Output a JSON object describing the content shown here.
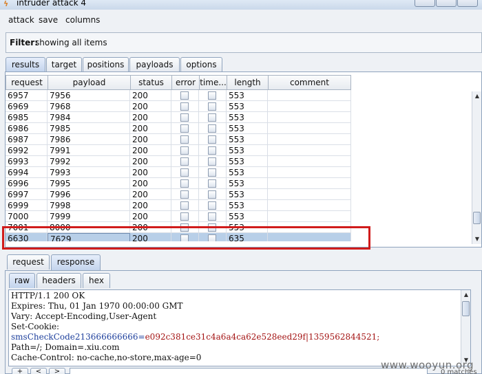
{
  "window": {
    "title": "intruder attack 4"
  },
  "menu": [
    "attack",
    "save",
    "columns"
  ],
  "filter": {
    "label": "Filter:",
    "value": "showing all items"
  },
  "main_tabs": [
    {
      "label": "results",
      "active": true
    },
    {
      "label": "target",
      "active": false
    },
    {
      "label": "positions",
      "active": false
    },
    {
      "label": "payloads",
      "active": false
    },
    {
      "label": "options",
      "active": false
    }
  ],
  "table": {
    "columns": [
      "request",
      "payload",
      "status",
      "error",
      "time...",
      "length",
      "comment"
    ],
    "rows": [
      {
        "request": "6957",
        "payload": "7956",
        "status": "200",
        "length": "553"
      },
      {
        "request": "6969",
        "payload": "7968",
        "status": "200",
        "length": "553"
      },
      {
        "request": "6985",
        "payload": "7984",
        "status": "200",
        "length": "553"
      },
      {
        "request": "6986",
        "payload": "7985",
        "status": "200",
        "length": "553"
      },
      {
        "request": "6987",
        "payload": "7986",
        "status": "200",
        "length": "553"
      },
      {
        "request": "6992",
        "payload": "7991",
        "status": "200",
        "length": "553"
      },
      {
        "request": "6993",
        "payload": "7992",
        "status": "200",
        "length": "553"
      },
      {
        "request": "6994",
        "payload": "7993",
        "status": "200",
        "length": "553"
      },
      {
        "request": "6996",
        "payload": "7995",
        "status": "200",
        "length": "553"
      },
      {
        "request": "6997",
        "payload": "7996",
        "status": "200",
        "length": "553"
      },
      {
        "request": "6999",
        "payload": "7998",
        "status": "200",
        "length": "553"
      },
      {
        "request": "7000",
        "payload": "7999",
        "status": "200",
        "length": "553"
      },
      {
        "request": "7001",
        "payload": "8000",
        "status": "200",
        "length": "553"
      },
      {
        "request": "6630",
        "payload": "7629",
        "status": "200",
        "length": "635",
        "selected": true
      }
    ]
  },
  "detail_tabs": [
    {
      "label": "request",
      "active": false
    },
    {
      "label": "response",
      "active": true
    }
  ],
  "view_tabs": [
    {
      "label": "raw",
      "active": true
    },
    {
      "label": "headers",
      "active": false
    },
    {
      "label": "hex",
      "active": false
    }
  ],
  "response": {
    "lines": [
      "HTTP/1.1 200 OK",
      "Expires: Thu, 01 Jan 1970 00:00:00 GMT",
      "Vary: Accept-Encoding,User-Agent",
      "Set-Cookie:"
    ],
    "cookie_name": "smsCheckCode213666666666",
    "cookie_eq": "=",
    "cookie_value": "e092c381ce31c4a6a4ca62e528eed29f|1359562844521;",
    "lines_after": [
      "Path=/; Domain=.xiu.com",
      "Cache-Control: no-cache,no-store,max-age=0"
    ]
  },
  "bottom": {
    "buttons": [
      "+",
      "<",
      ">"
    ],
    "matches_label": "0 matches"
  },
  "watermark": "www.wooyun.org",
  "colors": {
    "highlight": "#d01b1b",
    "selected_row": "#b8cfe8",
    "cookie_name": "#1d3f9c",
    "cookie_value": "#a31313"
  }
}
